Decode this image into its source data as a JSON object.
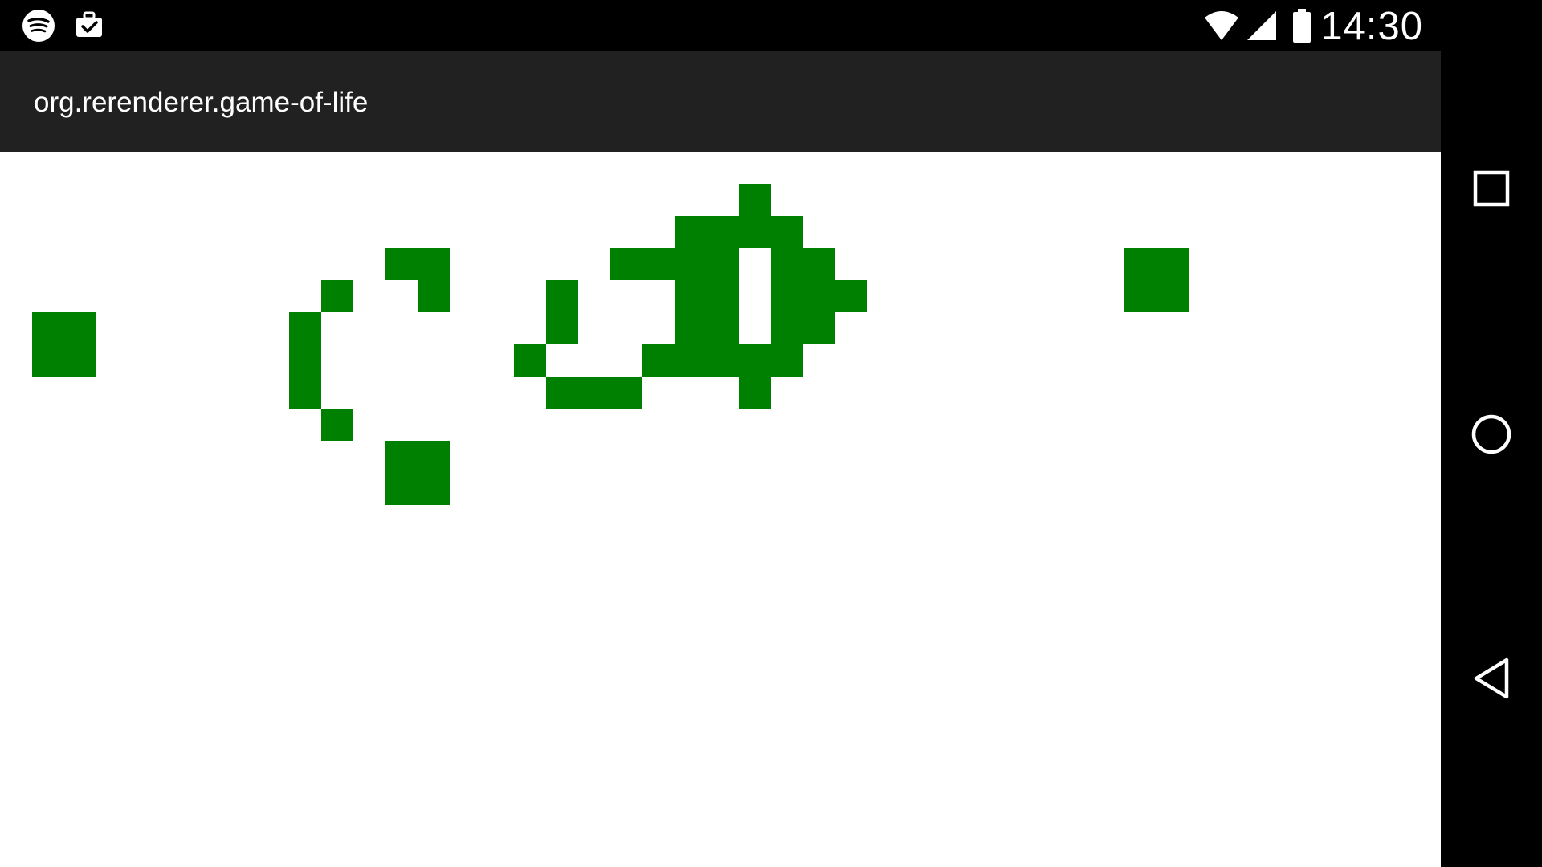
{
  "status_bar": {
    "time": "14:30",
    "left_icons": [
      "spotify-icon",
      "briefcase-check-icon"
    ],
    "right_icons": [
      "wifi-icon",
      "signal-icon",
      "battery-icon"
    ]
  },
  "app_bar": {
    "title": "org.rerenderer.game-of-life"
  },
  "board": {
    "cell_color": "#008000",
    "background": "#ffffff",
    "live_cells": [
      [
        1,
        5
      ],
      [
        2,
        5
      ],
      [
        1,
        6
      ],
      [
        2,
        6
      ],
      [
        10,
        4
      ],
      [
        9,
        5
      ],
      [
        9,
        6
      ],
      [
        9,
        7
      ],
      [
        10,
        8
      ],
      [
        12,
        3
      ],
      [
        13,
        3
      ],
      [
        13,
        4
      ],
      [
        12,
        9
      ],
      [
        13,
        9
      ],
      [
        12,
        10
      ],
      [
        13,
        10
      ],
      [
        17,
        4
      ],
      [
        17,
        5
      ],
      [
        16,
        6
      ],
      [
        17,
        7
      ],
      [
        18,
        7
      ],
      [
        19,
        7
      ],
      [
        19,
        3
      ],
      [
        20,
        3
      ],
      [
        20,
        6
      ],
      [
        21,
        2
      ],
      [
        21,
        3
      ],
      [
        21,
        4
      ],
      [
        21,
        5
      ],
      [
        21,
        6
      ],
      [
        22,
        2
      ],
      [
        22,
        3
      ],
      [
        22,
        4
      ],
      [
        22,
        5
      ],
      [
        22,
        6
      ],
      [
        23,
        1
      ],
      [
        23,
        2
      ],
      [
        23,
        6
      ],
      [
        23,
        7
      ],
      [
        24,
        2
      ],
      [
        24,
        3
      ],
      [
        24,
        4
      ],
      [
        24,
        5
      ],
      [
        24,
        6
      ],
      [
        25,
        3
      ],
      [
        25,
        4
      ],
      [
        25,
        5
      ],
      [
        26,
        4
      ],
      [
        35,
        3
      ],
      [
        36,
        3
      ],
      [
        35,
        4
      ],
      [
        36,
        4
      ]
    ]
  },
  "nav_bar": {
    "buttons": [
      "recents-square-icon",
      "home-circle-icon",
      "back-triangle-icon"
    ]
  },
  "colors": {
    "status_bar": "#000000",
    "app_bar": "#212121",
    "nav_bar": "#000000",
    "cell": "#008000"
  }
}
